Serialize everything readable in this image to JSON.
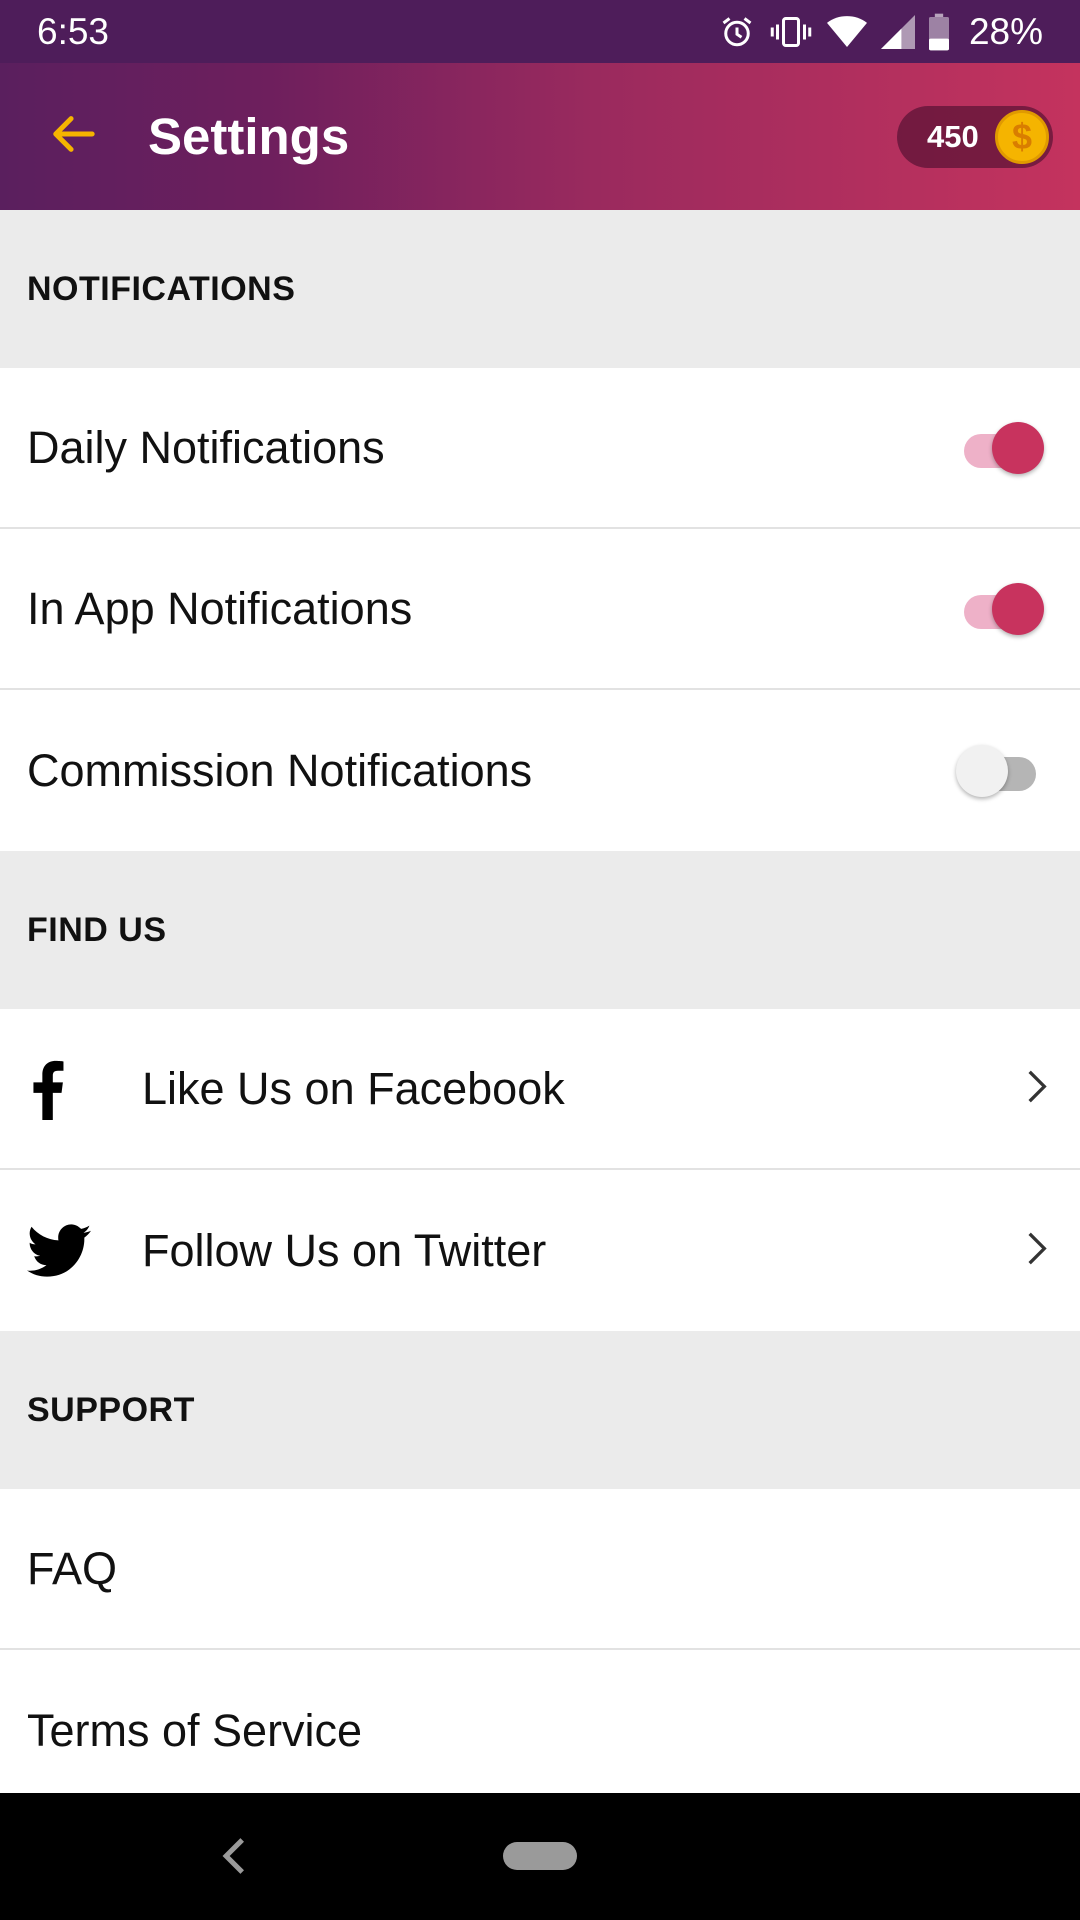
{
  "status_bar": {
    "time": "6:53",
    "battery": "28%",
    "icons": [
      "alarm-icon",
      "vibrate-icon",
      "wifi-icon",
      "signal-icon",
      "battery-icon"
    ]
  },
  "app_bar": {
    "title": "Settings",
    "coins": "450",
    "coin_symbol": "$",
    "accent": "#f5b400"
  },
  "sections": {
    "notifications": {
      "header": "NOTIFICATIONS",
      "items": [
        {
          "label": "Daily Notifications",
          "enabled": true
        },
        {
          "label": "In App Notifications",
          "enabled": true
        },
        {
          "label": "Commission Notifications",
          "enabled": false
        }
      ]
    },
    "find_us": {
      "header": "FIND US",
      "items": [
        {
          "label": "Like Us on Facebook",
          "icon": "facebook-icon"
        },
        {
          "label": "Follow Us on Twitter",
          "icon": "twitter-icon"
        }
      ]
    },
    "support": {
      "header": "SUPPORT",
      "items": [
        {
          "label": "FAQ"
        },
        {
          "label": "Terms of Service"
        }
      ]
    }
  },
  "colors": {
    "toggle_on": "#c8335e",
    "header_gradient_start": "#5a1f5e",
    "header_gradient_end": "#c4335e"
  }
}
